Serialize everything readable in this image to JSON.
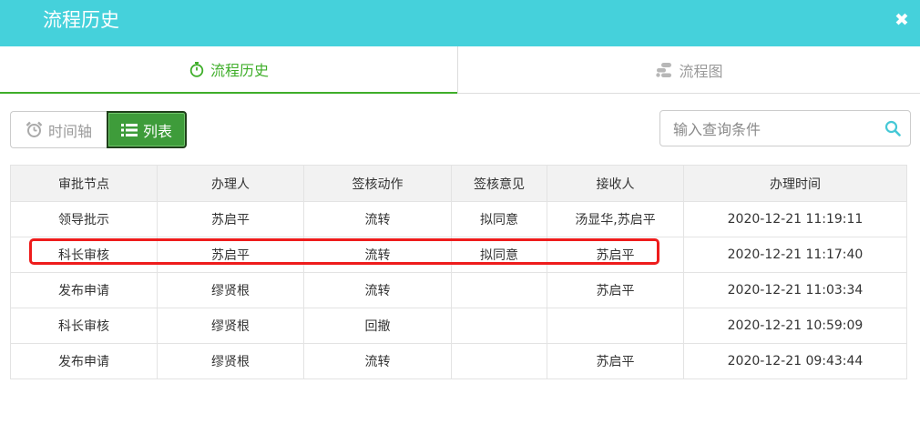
{
  "dialog": {
    "title": "流程历史",
    "close_icon": "close-icon"
  },
  "tabs": [
    {
      "label": "流程历史",
      "icon": "stopwatch-icon",
      "active": true
    },
    {
      "label": "流程图",
      "icon": "flowchart-icon",
      "active": false
    }
  ],
  "toolbar": {
    "timeline_label": "时间轴",
    "timeline_icon": "alarm-clock-icon",
    "list_label": "列表",
    "list_icon": "list-icon",
    "search_placeholder": "输入查询条件",
    "search_icon": "search-icon"
  },
  "table": {
    "headers": [
      "审批节点",
      "办理人",
      "签核动作",
      "签核意见",
      "接收人",
      "办理时间"
    ],
    "rows": [
      [
        "领导批示",
        "苏启平",
        "流转",
        "拟同意",
        "汤显华,苏启平",
        "2020-12-21 11:19:11"
      ],
      [
        "科长审核",
        "苏启平",
        "流转",
        "拟同意",
        "苏启平",
        "2020-12-21 11:17:40"
      ],
      [
        "发布申请",
        "缪贤根",
        "流转",
        "",
        "苏启平",
        "2020-12-21 11:03:34"
      ],
      [
        "科长审核",
        "缪贤根",
        "回撤",
        "",
        "",
        "2020-12-21 10:59:09"
      ],
      [
        "发布申请",
        "缪贤根",
        "流转",
        "",
        "苏启平",
        "2020-12-21 09:43:44"
      ]
    ]
  },
  "colors": {
    "titlebar": "#45d1db",
    "active_tab": "#3fae2a",
    "list_button": "#3e9c3a",
    "highlight": "#ee1c1c"
  }
}
